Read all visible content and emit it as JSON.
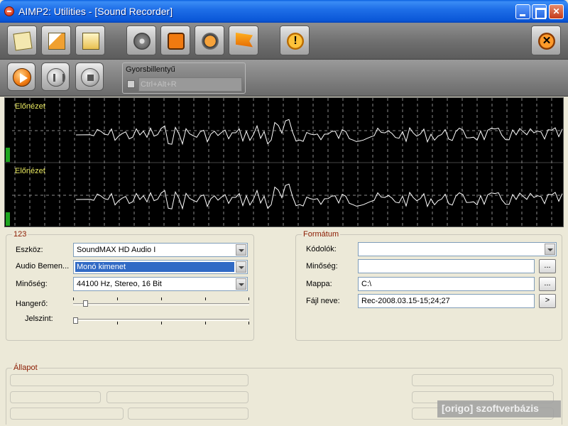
{
  "window": {
    "title": "AIMP2: Utilities - [Sound Recorder]",
    "controls": [
      "minimize",
      "maximize",
      "close"
    ]
  },
  "toolbar": {
    "icons": [
      "sound-recorder-icon",
      "disc-icon",
      "tag-editor-icon",
      "settings-gear-icon",
      "orange-square-icon",
      "aimp-logo-icon",
      "flag-icon",
      "warning-icon",
      "close-circle-icon"
    ]
  },
  "transport": {
    "icons": [
      "play-icon",
      "pause-icon",
      "stop-icon"
    ]
  },
  "hotkey": {
    "label": "Gyorsbillentyű",
    "value": "Ctrl+Alt+R"
  },
  "preview": {
    "label_top": "Előnézet",
    "label_bottom": "Előnézet",
    "accent": "#e8e860",
    "waveform_color": "#ffffff"
  },
  "device_group": {
    "title": "123",
    "device_label": "Eszköz:",
    "device_value": "SoundMAX HD Audio I",
    "input_label": "Audio Bemen...",
    "input_value": "Monó kimenet",
    "quality_label": "Minőség:",
    "quality_value": "44100 Hz, Stereo, 16 Bit",
    "volume_label": "Hangerő:",
    "volume_level": 0.06,
    "threshold_label": "Jelszint:",
    "threshold_level": 0.0
  },
  "format_group": {
    "title": "Formátum",
    "codec_label": "Kódolók:",
    "codec_value": "",
    "quality_label": "Minőség:",
    "quality_value": "",
    "quality_button": "...",
    "folder_label": "Mappa:",
    "folder_value": "C:\\",
    "folder_button": "...",
    "filename_label": "Fájl neve:",
    "filename_value": "Rec-2008.03.15-15;24;27",
    "filename_button": ">"
  },
  "status_group": {
    "title": "Állapot"
  },
  "watermark": {
    "text": "[origo] szoftverbázis"
  }
}
